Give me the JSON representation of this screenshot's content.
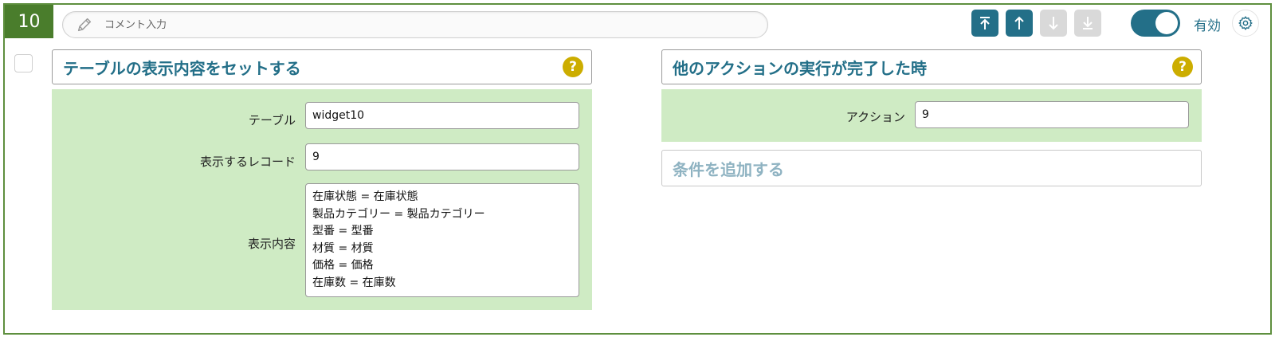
{
  "step": {
    "number": "10"
  },
  "comment": {
    "placeholder": "コメント入力",
    "value": ""
  },
  "toolbar": {
    "buttons": [
      {
        "name": "move-top",
        "icon": "arrow-to-top-icon",
        "enabled": true
      },
      {
        "name": "move-up",
        "icon": "arrow-up-icon",
        "enabled": true
      },
      {
        "name": "move-down",
        "icon": "arrow-down-icon",
        "enabled": false
      },
      {
        "name": "move-bottom",
        "icon": "arrow-to-bottom-icon",
        "enabled": false
      }
    ],
    "toggle_label": "有効",
    "toggle_on": true,
    "settings_icon": "gear-icon"
  },
  "action": {
    "title": "テーブルの表示内容をセットする",
    "help": "?",
    "fields": {
      "table_label": "テーブル",
      "table_value": "widget10",
      "record_label": "表示するレコード",
      "record_value": "9",
      "content_label": "表示内容",
      "content_lines": [
        "在庫状態 = 在庫状態",
        "製品カテゴリー = 製品カテゴリー",
        "型番 = 型番",
        "材質 = 材質",
        "価格 = 価格",
        "在庫数 = 在庫数"
      ]
    }
  },
  "trigger": {
    "title": "他のアクションの実行が完了した時",
    "help": "?",
    "action_label": "アクション",
    "action_value": "9",
    "add_condition": "条件を追加する"
  },
  "colors": {
    "accent": "#236f88",
    "step_badge": "#4a7d2c",
    "panel_bg": "#cfebc4",
    "help": "#ccad00",
    "disabled": "#d9d9d9"
  }
}
